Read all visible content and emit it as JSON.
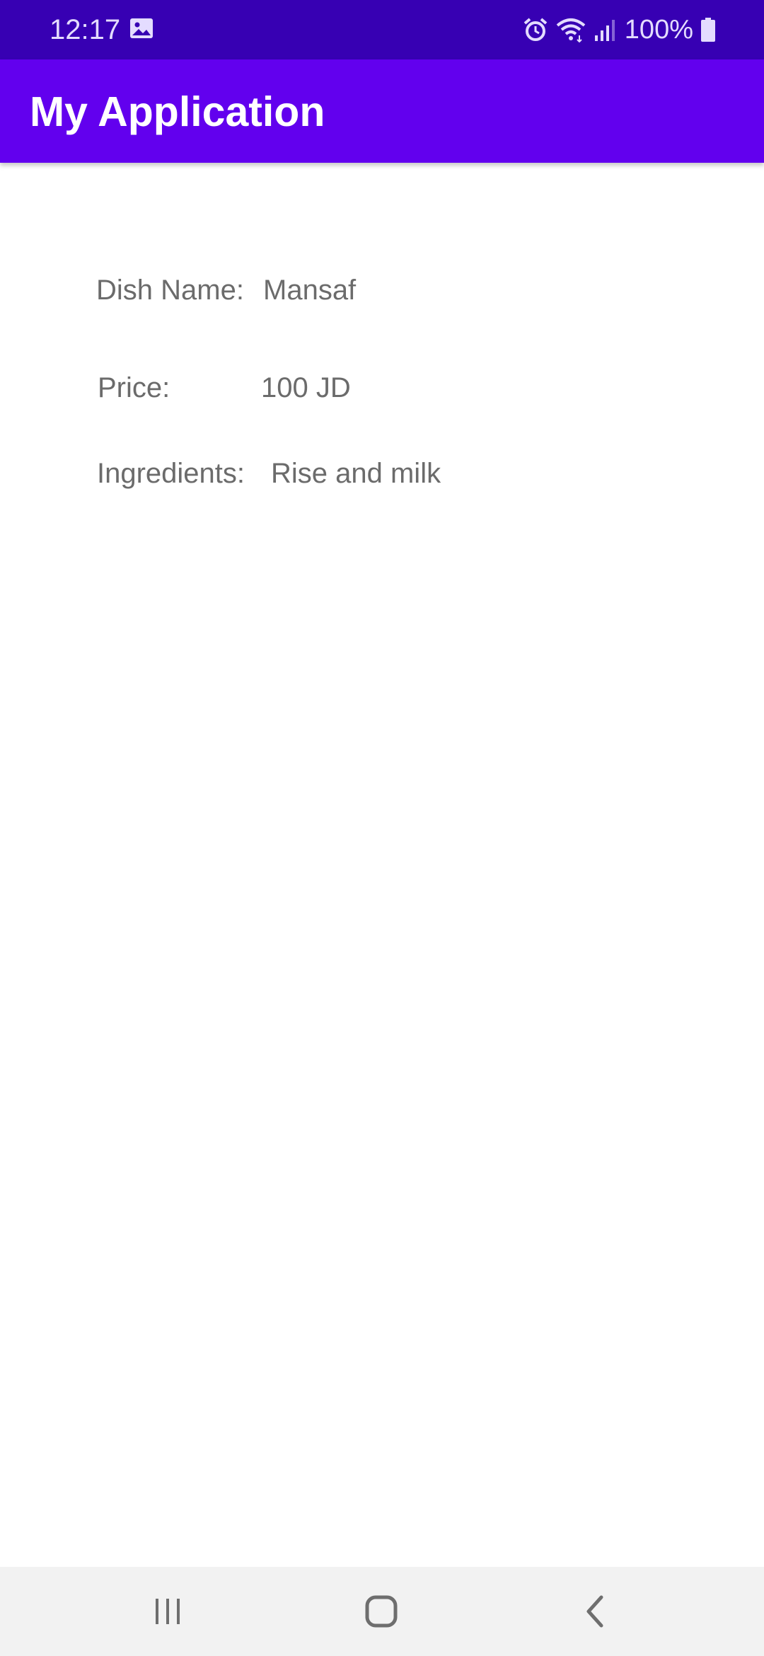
{
  "status_bar": {
    "time": "12:17",
    "battery": "100%",
    "icons": [
      "image-icon",
      "alarm-icon",
      "wifi-icon",
      "signal-icon",
      "battery-icon"
    ]
  },
  "app_bar": {
    "title": "My Application"
  },
  "details": {
    "dish_name_label": "Dish Name:",
    "dish_name_value": "Mansaf",
    "price_label": "Price:",
    "price_value": "100 JD",
    "ingredients_label": "Ingredients:",
    "ingredients_value": "Rise and milk"
  },
  "nav_bar": {
    "icons": [
      "recent-apps-icon",
      "home-icon",
      "back-icon"
    ]
  },
  "colors": {
    "status_bar": "#3700b3",
    "app_bar": "#6200ee",
    "text": "#6b6b6b",
    "nav_bar": "#f2f2f2"
  }
}
